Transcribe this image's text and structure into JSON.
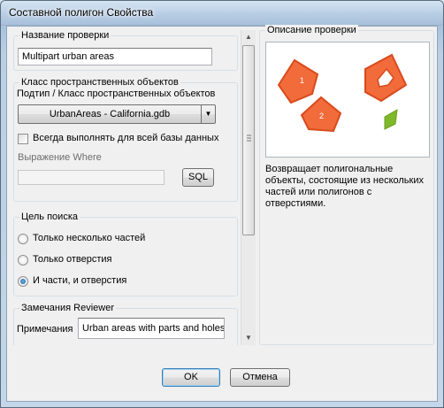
{
  "window": {
    "title": "Составной полигон Свойства"
  },
  "check_name": {
    "legend": "Название проверки",
    "value": "Multipart urban areas"
  },
  "feature_class": {
    "legend": "Класс пространственных объектов",
    "subtype_label": "Подтип / Класс пространственных объектов",
    "selected": "UrbanAreas - California.gdb",
    "always_run_label": "Всегда выполнять для всей базы данных",
    "where_label": "Выражение Where",
    "where_value": "",
    "sql_button": "SQL"
  },
  "search_goal": {
    "legend": "Цель поиска",
    "options": [
      "Только несколько частей",
      "Только отверстия",
      "И части, и отверстия"
    ],
    "selected_index": 2
  },
  "reviewer": {
    "legend": "Замечания Reviewer",
    "notes_label": "Примечания",
    "notes_value": "Urban areas with parts and holes"
  },
  "description": {
    "legend": "Описание проверки",
    "text": "Возвращает полигональные объекты, состоящие из нескольких частей или полигонов с отверстиями.",
    "image_labels": [
      "1",
      "2"
    ],
    "colors": {
      "polygon_fill": "#f26b3a",
      "polygon_stroke": "#d94a1c",
      "green_fill": "#7fb82a"
    }
  },
  "buttons": {
    "ok": "OK",
    "cancel": "Отмена"
  }
}
